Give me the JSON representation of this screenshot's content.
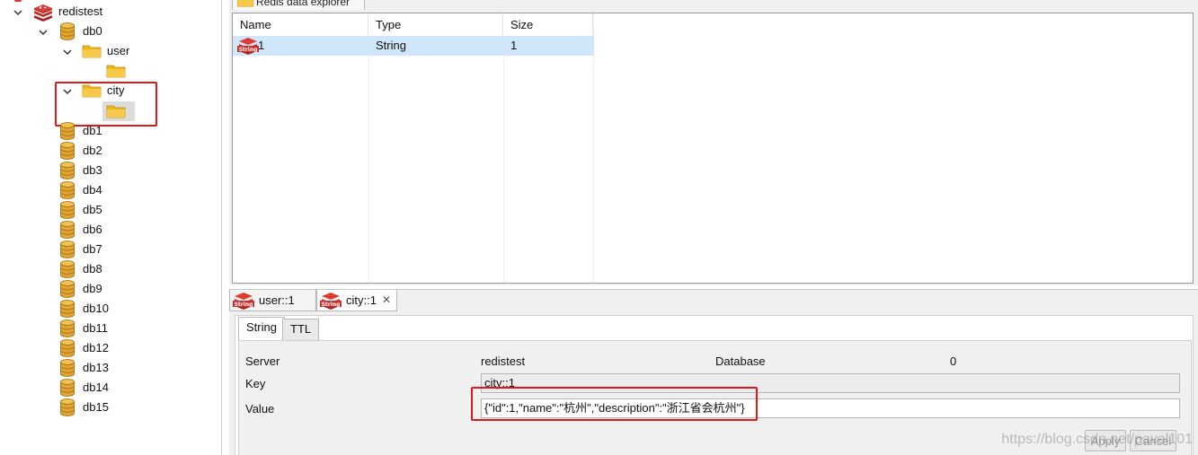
{
  "tree": {
    "server": "redistest",
    "db0": "db0",
    "folder_user": "user",
    "folder_city": "city",
    "other_dbs": [
      "db1",
      "db2",
      "db3",
      "db4",
      "db5",
      "db6",
      "db7",
      "db8",
      "db9",
      "db10",
      "db11",
      "db12",
      "db13",
      "db14",
      "db15"
    ]
  },
  "explorer": {
    "tab_title": "Redis data explorer",
    "columns": [
      "Name",
      "Type",
      "Size"
    ],
    "rows": [
      {
        "name": "1",
        "type": "String",
        "size": "1",
        "icon": "string-key-icon"
      }
    ]
  },
  "editor": {
    "tabs": [
      {
        "label": "user::1",
        "icon": "string-key-icon"
      },
      {
        "label": "city::1",
        "icon": "string-key-icon"
      }
    ],
    "sub_tabs": [
      "String",
      "TTL"
    ],
    "fields": {
      "server_label": "Server",
      "server_value": "redistest",
      "database_label": "Database",
      "database_value": "0",
      "key_label": "Key",
      "key_value": "city::1",
      "value_label": "Value",
      "value_value": "{\"id\":1,\"name\":\"杭州\",\"description\":\"浙江省会杭州\"}"
    },
    "buttons": {
      "apply": "Apply",
      "cancel": "Cancel"
    }
  },
  "watermark": "https://blog.csdn.net/pavel101",
  "colors": {
    "highlight": "#e0191b",
    "selection": "#cfe6fb",
    "redis_red": "#c8312b",
    "folder": "#f0b51c",
    "db_gold": "#e0a531"
  }
}
